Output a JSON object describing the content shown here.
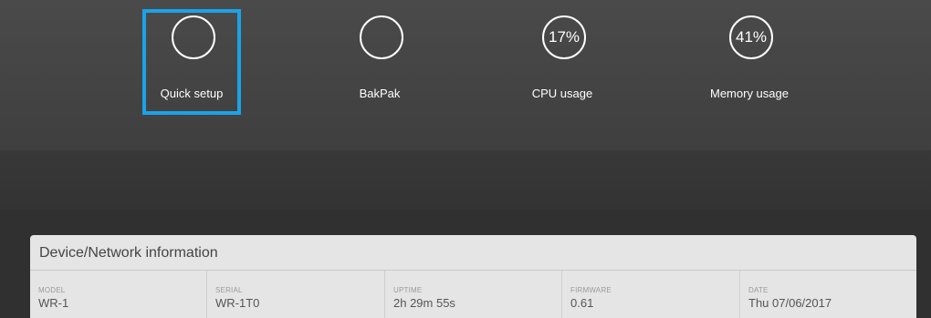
{
  "dashboard": {
    "tiles": [
      {
        "label": "Quick setup",
        "value": ""
      },
      {
        "label": "BakPak",
        "value": ""
      },
      {
        "label": "CPU usage",
        "value": "17%"
      },
      {
        "label": "Memory usage",
        "value": "41%"
      }
    ]
  },
  "info_card": {
    "title": "Device/Network information",
    "fields": [
      {
        "key": "MODEL",
        "value": "WR-1"
      },
      {
        "key": "SERIAL",
        "value": "WR-1T0"
      },
      {
        "key": "UPTIME",
        "value": "2h 29m 55s"
      },
      {
        "key": "FIRMWARE",
        "value": "0.61"
      },
      {
        "key": "DATE",
        "value": "Thu 07/06/2017"
      }
    ]
  },
  "colors": {
    "highlight": "#1aa3e8",
    "card_background": "#e5e5e5",
    "ring": "#ffffff"
  }
}
